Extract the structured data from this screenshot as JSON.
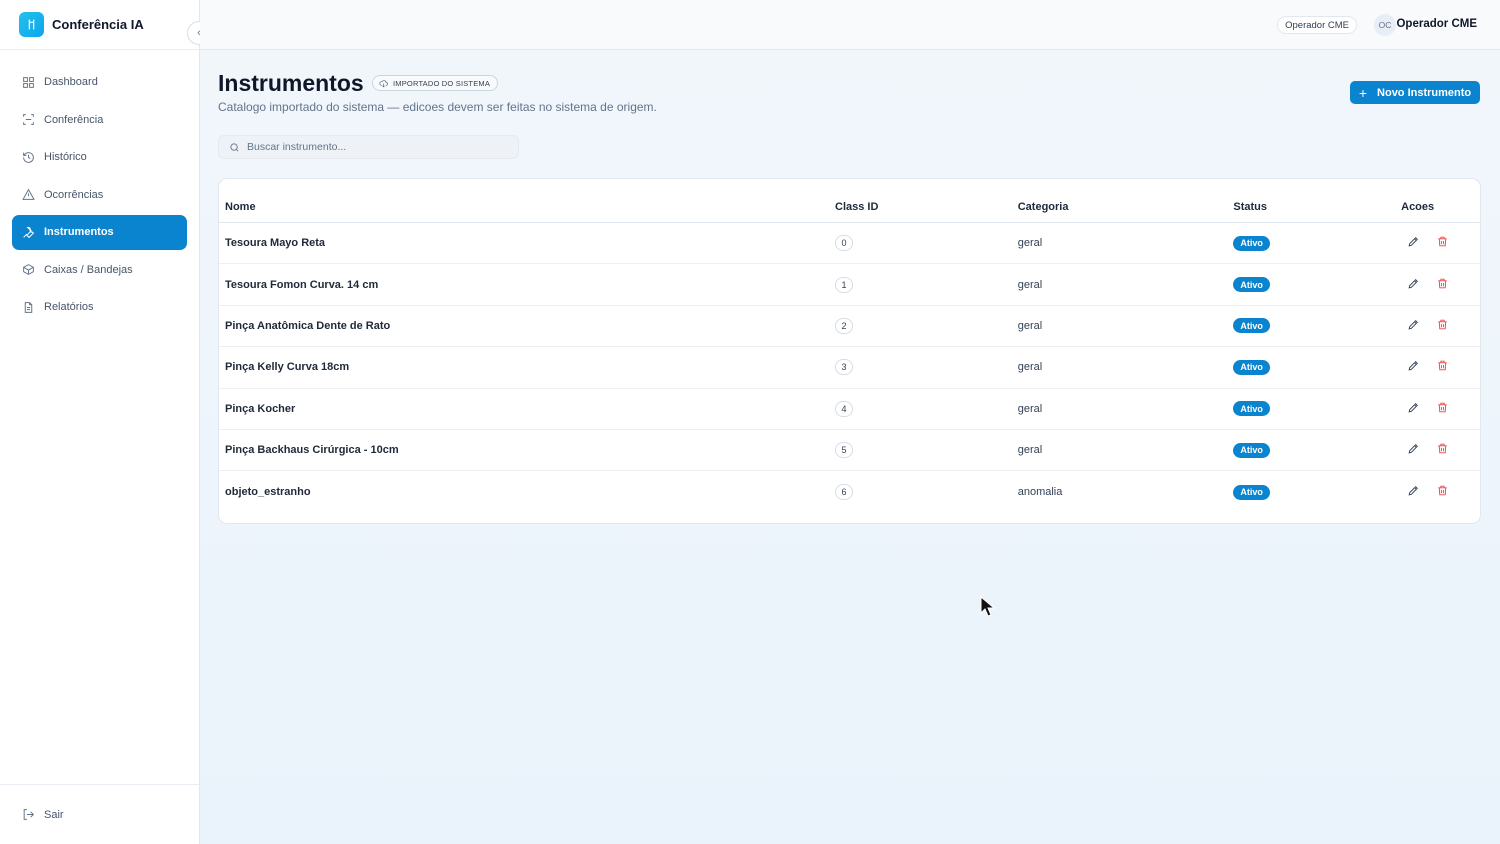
{
  "brand": {
    "name": "Conferência IA"
  },
  "sidebar": {
    "items": [
      {
        "label": "Dashboard",
        "icon": "grid-icon"
      },
      {
        "label": "Conferência",
        "icon": "scan-icon"
      },
      {
        "label": "Histórico",
        "icon": "history-icon"
      },
      {
        "label": "Ocorrências",
        "icon": "alert-triangle-icon"
      },
      {
        "label": "Instrumentos",
        "icon": "wrench-icon",
        "active": true
      },
      {
        "label": "Caixas / Bandejas",
        "icon": "box-icon"
      },
      {
        "label": "Relatórios",
        "icon": "file-text-icon"
      }
    ],
    "logout_label": "Sair"
  },
  "topbar": {
    "role_badge": "Operador CME",
    "avatar_initials": "OC",
    "user_name": "Operador CME"
  },
  "page": {
    "title": "Instrumentos",
    "import_badge": "IMPORTADO DO SISTEMA",
    "subtitle": "Catalogo importado do sistema — edicoes devem ser feitas no sistema de origem.",
    "new_button": "Novo Instrumento",
    "search_placeholder": "Buscar instrumento..."
  },
  "table": {
    "headers": {
      "name": "Nome",
      "class_id": "Class ID",
      "category": "Categoria",
      "status": "Status",
      "actions": "Acoes"
    },
    "rows": [
      {
        "name": "Tesoura Mayo Reta",
        "class_id": "0",
        "category": "geral",
        "status": "Ativo"
      },
      {
        "name": "Tesoura Fomon Curva. 14 cm",
        "class_id": "1",
        "category": "geral",
        "status": "Ativo"
      },
      {
        "name": "Pinça Anatômica Dente de Rato",
        "class_id": "2",
        "category": "geral",
        "status": "Ativo"
      },
      {
        "name": "Pinça Kelly Curva 18cm",
        "class_id": "3",
        "category": "geral",
        "status": "Ativo"
      },
      {
        "name": "Pinça Kocher",
        "class_id": "4",
        "category": "geral",
        "status": "Ativo"
      },
      {
        "name": "Pinça Backhaus Cirúrgica - 10cm",
        "class_id": "5",
        "category": "geral",
        "status": "Ativo"
      },
      {
        "name": "objeto_estranho",
        "class_id": "6",
        "category": "anomalia",
        "status": "Ativo"
      }
    ]
  },
  "colors": {
    "accent": "#0b84d0",
    "danger": "#ef4444"
  }
}
